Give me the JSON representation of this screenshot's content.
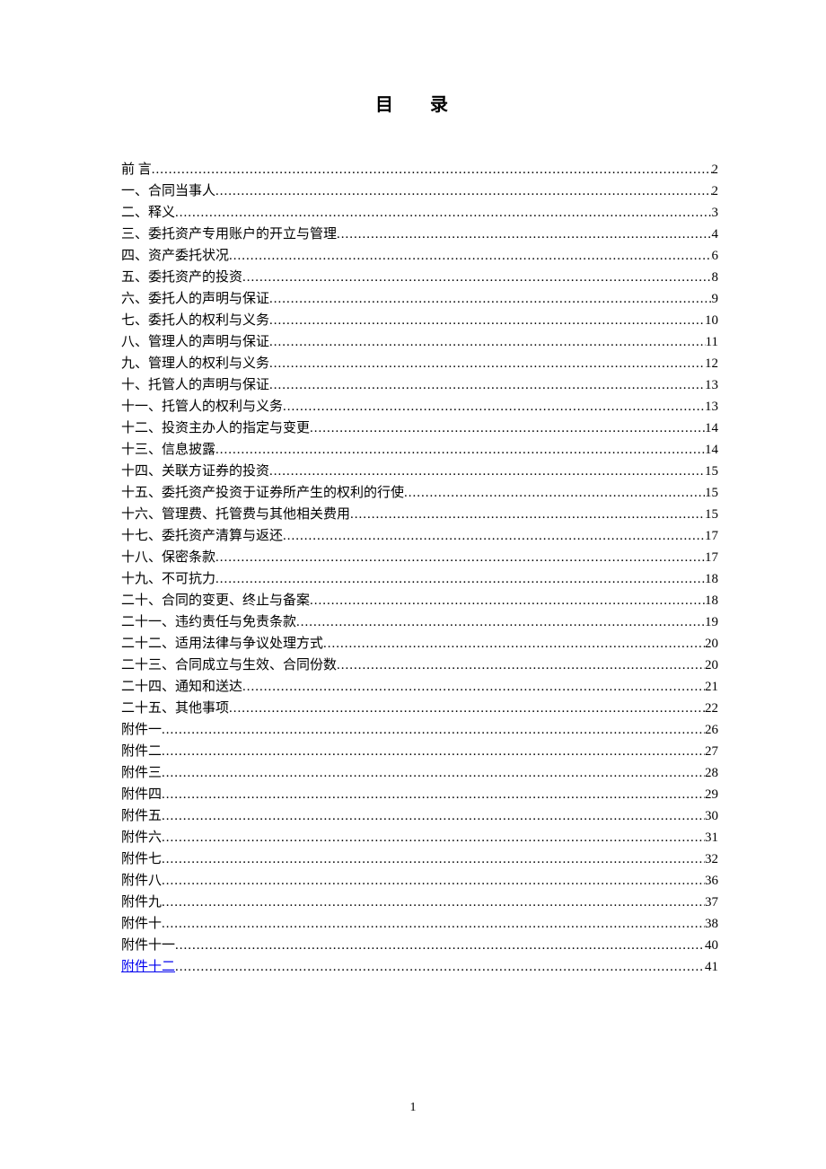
{
  "title": "目 录",
  "entries": [
    {
      "label": "前   言",
      "page": "2",
      "link": false
    },
    {
      "label": "一、合同当事人",
      "page": "2",
      "link": false
    },
    {
      "label": "二、释义",
      "page": "3",
      "link": false
    },
    {
      "label": "三、委托资产专用账户的开立与管理",
      "page": "4",
      "link": false
    },
    {
      "label": "四、资产委托状况",
      "page": "6",
      "link": false
    },
    {
      "label": "五、委托资产的投资",
      "page": "8",
      "link": false
    },
    {
      "label": "六、委托人的声明与保证",
      "page": "9",
      "link": false
    },
    {
      "label": "七、委托人的权利与义务",
      "page": "10",
      "link": false
    },
    {
      "label": "八、管理人的声明与保证",
      "page": "11",
      "link": false
    },
    {
      "label": "九、管理人的权利与义务",
      "page": "12",
      "link": false
    },
    {
      "label": "十、托管人的声明与保证",
      "page": "13",
      "link": false
    },
    {
      "label": "十一、托管人的权利与义务",
      "page": "13",
      "link": false
    },
    {
      "label": "十二、投资主办人的指定与变更",
      "page": "14",
      "link": false
    },
    {
      "label": "十三、信息披露",
      "page": "14",
      "link": false
    },
    {
      "label": "十四、关联方证券的投资",
      "page": "15",
      "link": false
    },
    {
      "label": "十五、委托资产投资于证券所产生的权利的行使",
      "page": "15",
      "link": false
    },
    {
      "label": "十六、管理费、托管费与其他相关费用",
      "page": "15",
      "link": false
    },
    {
      "label": "十七、委托资产清算与返还",
      "page": "17",
      "link": false
    },
    {
      "label": "十八、保密条款",
      "page": "17",
      "link": false
    },
    {
      "label": "十九、不可抗力",
      "page": "18",
      "link": false
    },
    {
      "label": "二十、合同的变更、终止与备案",
      "page": "18",
      "link": false
    },
    {
      "label": "二十一、违约责任与免责条款",
      "page": "19",
      "link": false
    },
    {
      "label": "二十二、适用法律与争议处理方式",
      "page": "20",
      "link": false
    },
    {
      "label": "二十三、合同成立与生效、合同份数",
      "page": "20",
      "link": false
    },
    {
      "label": "二十四、通知和送达",
      "page": "21",
      "link": false
    },
    {
      "label": "二十五、其他事项",
      "page": "22",
      "link": false
    },
    {
      "label": "附件一",
      "page": "26",
      "link": false
    },
    {
      "label": "附件二",
      "page": "27",
      "link": false
    },
    {
      "label": "附件三",
      "page": "28",
      "link": false
    },
    {
      "label": "附件四",
      "page": "29",
      "link": false
    },
    {
      "label": "附件五",
      "page": "30",
      "link": false
    },
    {
      "label": "附件六",
      "page": "31",
      "link": false
    },
    {
      "label": "附件七",
      "page": "32",
      "link": false
    },
    {
      "label": "附件八",
      "page": "36",
      "link": false
    },
    {
      "label": "附件九",
      "page": "37",
      "link": false
    },
    {
      "label": "附件十",
      "page": "38",
      "link": false
    },
    {
      "label": "附件十一",
      "page": "40",
      "link": false
    },
    {
      "label": "附件十二",
      "page": "41",
      "link": true
    }
  ],
  "page_number": "1"
}
